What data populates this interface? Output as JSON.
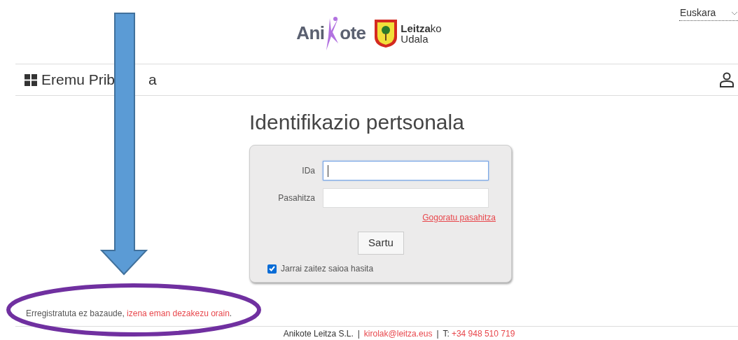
{
  "language_select": {
    "value": "Euskara"
  },
  "logos": {
    "anikote": [
      "Ani",
      "ote"
    ],
    "council": [
      "**Leitza**ko",
      "Udala"
    ]
  },
  "header": {
    "title_parts": [
      "Eremu Prib",
      "a"
    ]
  },
  "heading": "Identifikazio pertsonala",
  "form": {
    "fields": [
      {
        "label": "IDa",
        "focused": true
      },
      {
        "label": "Pasahitza",
        "focused": false
      }
    ],
    "forgot_link": "Gogoratu pasahitza",
    "submit": "Sartu",
    "remember": {
      "label": "Jarrai zaitez saioa hasita",
      "checked": true
    }
  },
  "register": {
    "text": "Erregistratuta ez bazaude, ",
    "link": "izena eman dezakezu orain",
    "end": "."
  },
  "footer": {
    "company": "Anikote Leitza S.L.",
    "separator_1": "|",
    "email": "kirolak@leitza.eus",
    "separator_2": "|",
    "phone_label": "T:",
    "phone": "+34 948 510 719"
  }
}
